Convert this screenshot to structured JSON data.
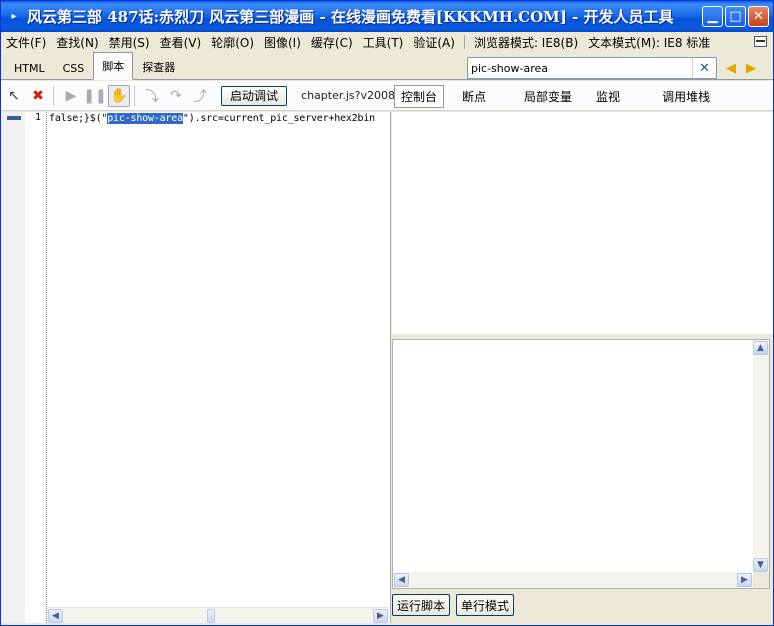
{
  "window": {
    "title": "风云第三部 487话:赤烈刀 风云第三部漫画 - 在线漫画免费看[KKKMH.COM] - 开发人员工具"
  },
  "menu": {
    "items": [
      "文件(F)",
      "查找(N)",
      "禁用(S)",
      "查看(V)",
      "轮廓(O)",
      "图像(I)",
      "缓存(C)",
      "工具(T)",
      "验证(A)"
    ],
    "browser_mode": "浏览器模式: IE8(B)",
    "document_mode": "文本模式(M): IE8 标准"
  },
  "tabs": [
    "HTML",
    "CSS",
    "脚本",
    "探查器"
  ],
  "active_tab": "脚本",
  "search": {
    "value": "pic-show-area"
  },
  "toolbar": {
    "start_debug": "启动调试",
    "file": "chapter.js?v2008"
  },
  "right_tabs": [
    "控制台",
    "断点",
    "局部变量",
    "监视",
    "调用堆栈"
  ],
  "active_right_tab": "控制台",
  "code": {
    "line_number": "1",
    "before": "false;}$(\"",
    "highlight": "pic-show-area",
    "after": "\").src=current_pic_server+hex2bin"
  },
  "buttons": {
    "run_script": "运行脚本",
    "single_line": "单行模式"
  },
  "colors": {
    "titlebar": "#0a5ae0",
    "highlight": "#3169c6",
    "window_bg": "#ece9d8"
  }
}
